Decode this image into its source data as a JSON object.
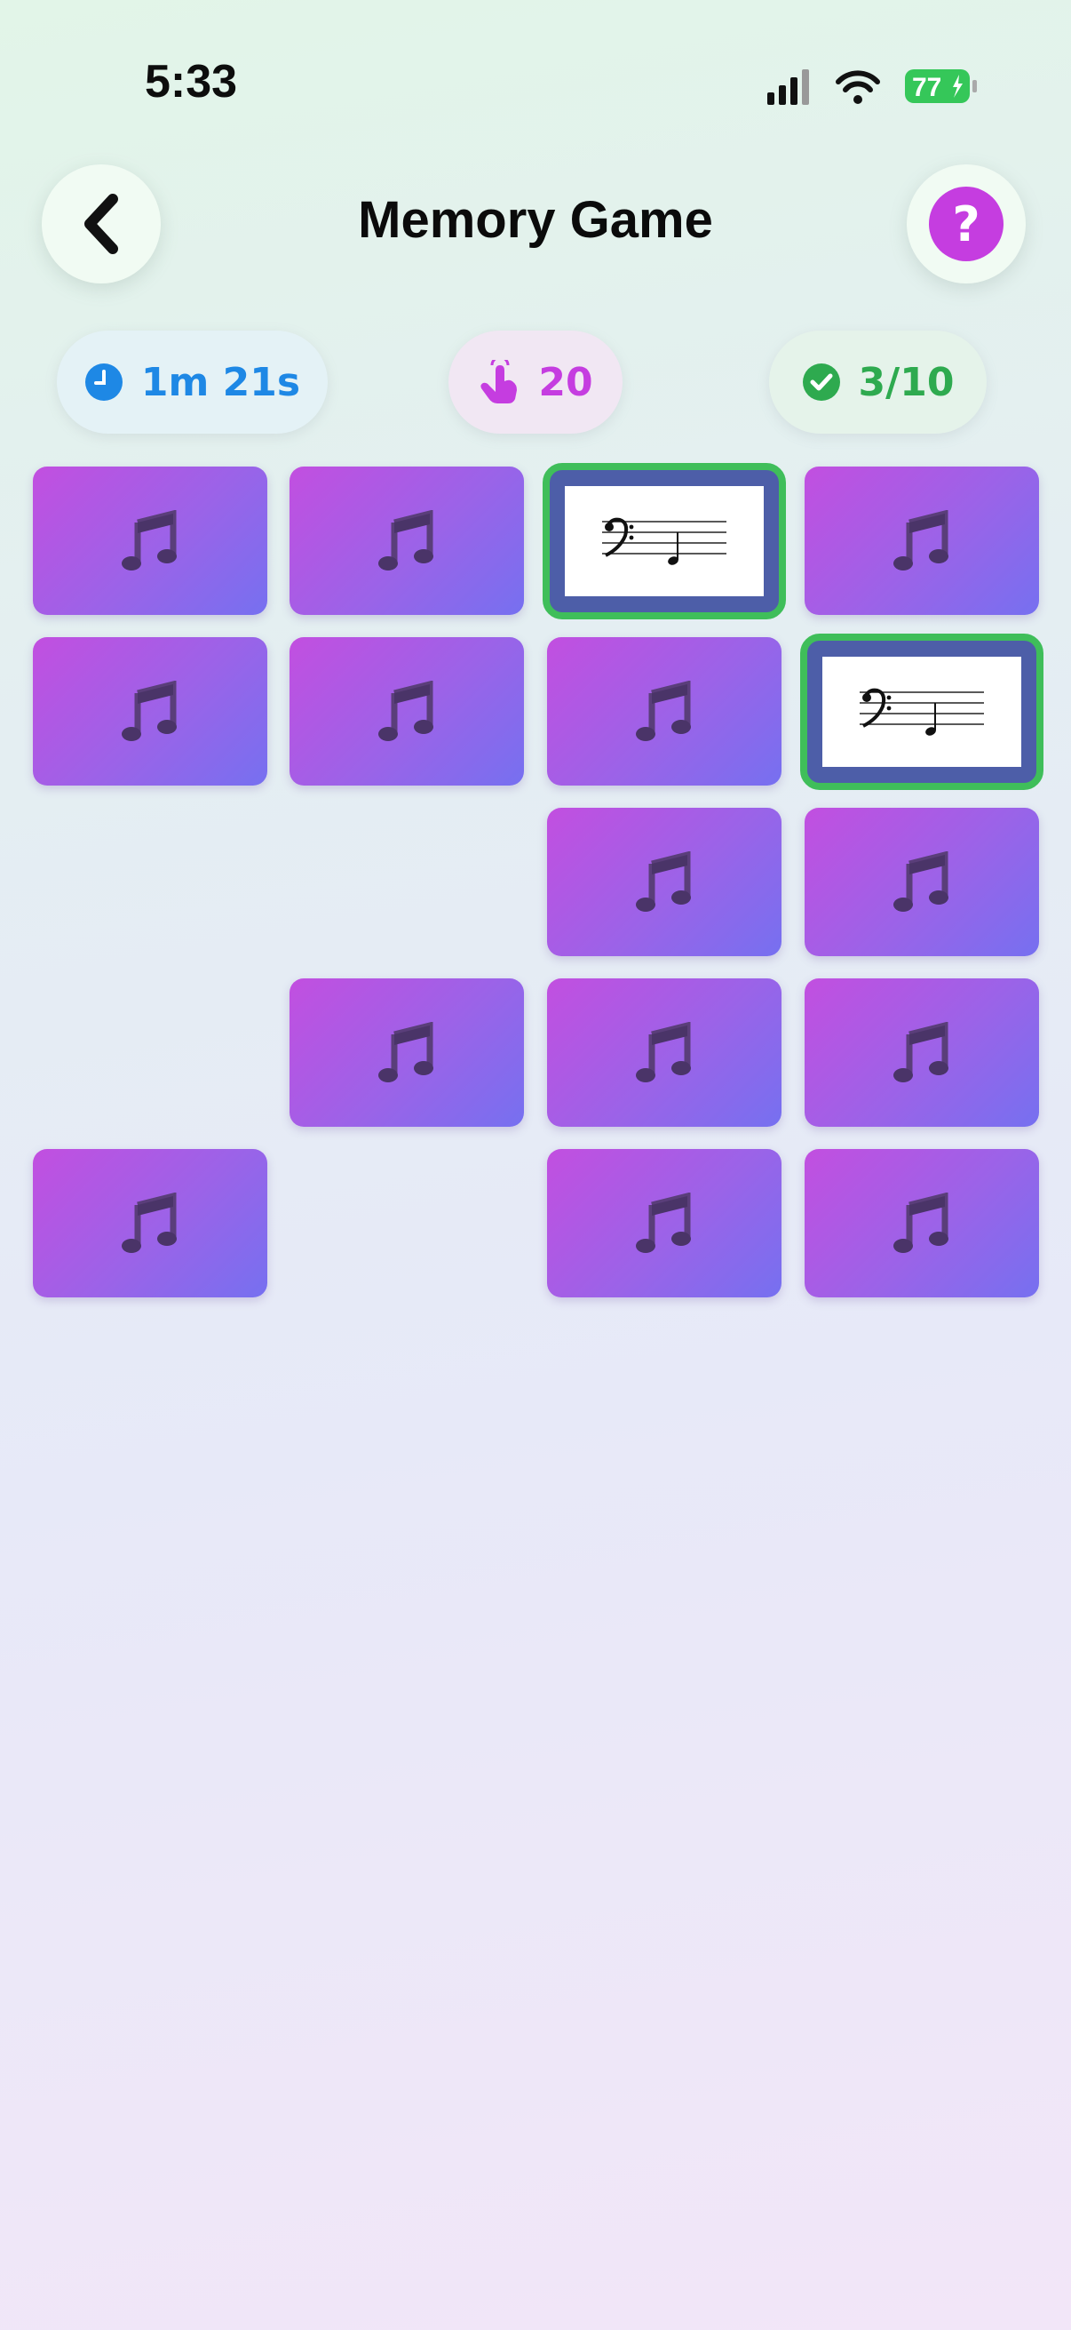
{
  "status_bar": {
    "time": "5:33",
    "battery": "77"
  },
  "header": {
    "title": "Memory Game"
  },
  "stats": {
    "time": "1m 21s",
    "moves": "20",
    "pairs": "3/10"
  },
  "colors": {
    "accent": "#c53de0",
    "timer": "#1e88e5",
    "success": "#2eaa4f",
    "card_back": "#9b63e8",
    "matched_border": "#3fbe5a"
  },
  "board": {
    "columns": 4,
    "rows": 5,
    "cells": [
      {
        "state": "hidden",
        "icon": "music-note-icon"
      },
      {
        "state": "hidden",
        "icon": "music-note-icon"
      },
      {
        "state": "flipped",
        "icon": "bass-clef-note-icon"
      },
      {
        "state": "hidden",
        "icon": "music-note-icon"
      },
      {
        "state": "hidden",
        "icon": "music-note-icon"
      },
      {
        "state": "hidden",
        "icon": "music-note-icon"
      },
      {
        "state": "hidden",
        "icon": "music-note-icon"
      },
      {
        "state": "flipped",
        "icon": "bass-clef-note-icon"
      },
      {
        "state": "empty"
      },
      {
        "state": "empty"
      },
      {
        "state": "hidden",
        "icon": "music-note-icon"
      },
      {
        "state": "hidden",
        "icon": "music-note-icon"
      },
      {
        "state": "empty"
      },
      {
        "state": "hidden",
        "icon": "music-note-icon"
      },
      {
        "state": "hidden",
        "icon": "music-note-icon"
      },
      {
        "state": "hidden",
        "icon": "music-note-icon"
      },
      {
        "state": "hidden",
        "icon": "music-note-icon"
      },
      {
        "state": "empty"
      },
      {
        "state": "hidden",
        "icon": "music-note-icon"
      },
      {
        "state": "hidden",
        "icon": "music-note-icon"
      }
    ]
  }
}
